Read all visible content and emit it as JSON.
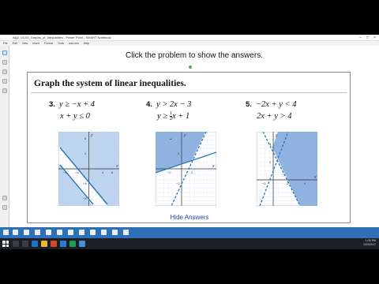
{
  "window": {
    "title": "Alg2_03-03_Graphs_of_Inequalities - Power Point - SMART Notebook"
  },
  "menu": [
    "File",
    "Edit",
    "View",
    "Insert",
    "Format",
    "Tools",
    "Add-ons",
    "Help"
  ],
  "slide": {
    "prompt": "Click the problem to show the answers.",
    "header": "Graph the system of linear inequalities.",
    "hide_answers": "Hide Answers",
    "problems": [
      {
        "number": "3.",
        "line1": "y ≥ −x + 4",
        "line2": "x + y ≤ 0"
      },
      {
        "number": "4.",
        "line1": "y > 2x − 3",
        "line2": "y ≥ ",
        "line2_frac_num": "1",
        "line2_frac_den": "2",
        "line2_rest": "x + 1"
      },
      {
        "number": "5.",
        "line1": "−2x + y < 4",
        "line2": "2x + y > 4"
      }
    ],
    "graph_labels": {
      "axis_y": "y",
      "axis_x": "x",
      "g3_ticks": [
        "8",
        "4",
        "−8",
        "−4",
        "4",
        "8",
        "−4",
        "−8"
      ],
      "g4_ticks": [
        "2",
        "−2",
        "2",
        "−2"
      ],
      "g5_ticks": [
        "4",
        "2",
        "−2",
        "2",
        "4"
      ]
    }
  },
  "tray": {
    "time": "1:05 PM",
    "date": "10/3/2017"
  },
  "colors": {
    "shade": "#a9c7ea",
    "shade_dark": "#7ea6dc",
    "line": "#2a77b8",
    "accent": "#2e6fb5"
  }
}
